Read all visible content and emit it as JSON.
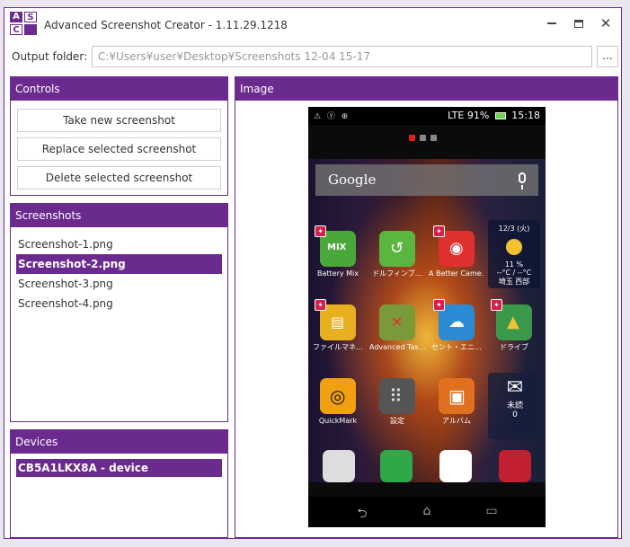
{
  "window": {
    "title": "Advanced Screenshot Creator - 1.11.29.1218",
    "logo_letters": [
      "A",
      "S",
      "C",
      ""
    ],
    "controls": {
      "minimize_icon": "minimize-icon",
      "maximize_icon": "maximize-icon",
      "close_glyph": "✕"
    }
  },
  "output": {
    "label": "Output folder:",
    "path": "C:¥Users¥user¥Desktop¥Screenshots 12-04 15-17",
    "browse_label": "..."
  },
  "controls_panel": {
    "title": "Controls",
    "buttons": [
      "Take new screenshot",
      "Replace selected screenshot",
      "Delete selected screenshot"
    ]
  },
  "screenshots_panel": {
    "title": "Screenshots",
    "items": [
      "Screenshot-1.png",
      "Screenshot-2.png",
      "Screenshot-3.png",
      "Screenshot-4.png"
    ],
    "selected_index": 1
  },
  "devices_panel": {
    "title": "Devices",
    "items": [
      "CB5A1LKX8A - device"
    ]
  },
  "image_panel": {
    "title": "Image",
    "phone": {
      "status": {
        "left_icons": "⚠ ⓨ ⊕",
        "signal": "LTE",
        "battery": "91%",
        "time": "15:18"
      },
      "search_label": "Google",
      "apps": [
        {
          "label": "Battery Mix",
          "color": "#4aa83a",
          "glyph": "MIX"
        },
        {
          "label": "ドルフィンブ…",
          "color": "#5bb640",
          "glyph": "↺"
        },
        {
          "label": "A Better Came…",
          "color": "#e03030",
          "glyph": "◉"
        },
        {
          "label": "ファイルマネ…",
          "color": "#e8b020",
          "glyph": "▤"
        },
        {
          "label": "Advanced Tas…",
          "color": "#7a9a3a",
          "glyph": "✕"
        },
        {
          "label": "セント・エニ…",
          "color": "#2a8ad4",
          "glyph": "☁"
        },
        {
          "label": "ドライブ",
          "color": "#3a9a4a",
          "glyph": "▲"
        },
        {
          "label": "QuickMark",
          "color": "#f0a010",
          "glyph": "◎"
        },
        {
          "label": "設定",
          "color": "#555555",
          "glyph": "⠿"
        },
        {
          "label": "アルバム",
          "color": "#e07020",
          "glyph": "▣"
        }
      ],
      "weather": {
        "date": "12/3 (火)",
        "percent": "11 %",
        "temps": "--°C / --°C",
        "place": "埼玉 西部"
      },
      "mail": {
        "label": "未読",
        "count": "0"
      },
      "dock": [
        {
          "name": "apps",
          "color": "#dddddd"
        },
        {
          "name": "phone",
          "color": "#2fa84a"
        },
        {
          "name": "store",
          "color": "#ffffff"
        },
        {
          "name": "tag",
          "color": "#c02030"
        }
      ],
      "nav": [
        "⮌",
        "⌂",
        "▭"
      ]
    }
  }
}
